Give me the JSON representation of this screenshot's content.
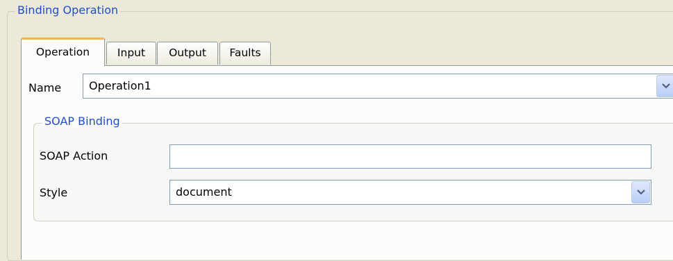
{
  "group": {
    "title": "Binding Operation"
  },
  "tabs": [
    {
      "label": "Operation",
      "active": true
    },
    {
      "label": "Input",
      "active": false
    },
    {
      "label": "Output",
      "active": false
    },
    {
      "label": "Faults",
      "active": false
    }
  ],
  "operation": {
    "name_label": "Name",
    "name_value": "Operation1",
    "name_dropdown_icon": "chevron-down-icon"
  },
  "soap_binding": {
    "title": "SOAP Binding",
    "soap_action_label": "SOAP Action",
    "soap_action_value": "",
    "style_label": "Style",
    "style_value": "document",
    "style_dropdown_icon": "chevron-down-icon"
  },
  "colors": {
    "window_background": "#ece9d8",
    "panel_background": "#fcfcfe",
    "group_title": "#1f4fd0",
    "active_tab_accent": "#f7b24a",
    "field_border": "#7f9db9"
  }
}
